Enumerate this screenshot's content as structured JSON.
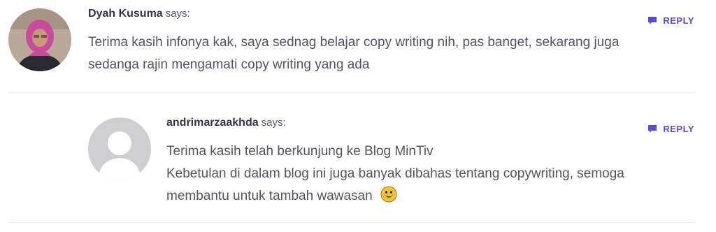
{
  "comments": [
    {
      "author": "Dyah Kusuma",
      "says": "says:",
      "reply_label": "REPLY",
      "text_lines": [
        "Terima kasih infonya kak, saya sednag belajar copy writing nih, pas banget, sekarang juga",
        "sedanga rajin mengamati copy writing yang ada"
      ]
    },
    {
      "author": "andrimarzaakhda",
      "says": "says:",
      "reply_label": "REPLY",
      "text_lines": [
        "Terima kasih telah berkunjung ke Blog MinTiv",
        "Kebetulan di dalam blog ini juga banyak dibahas tentang copywriting, semoga",
        "membantu untuk tambah wawasan"
      ]
    }
  ],
  "colors": {
    "accent": "#5b4ad6",
    "text": "#55535f",
    "author": "#33334a"
  },
  "icons": {
    "reply": "comment-icon",
    "emoji": "grinning-face-icon"
  }
}
